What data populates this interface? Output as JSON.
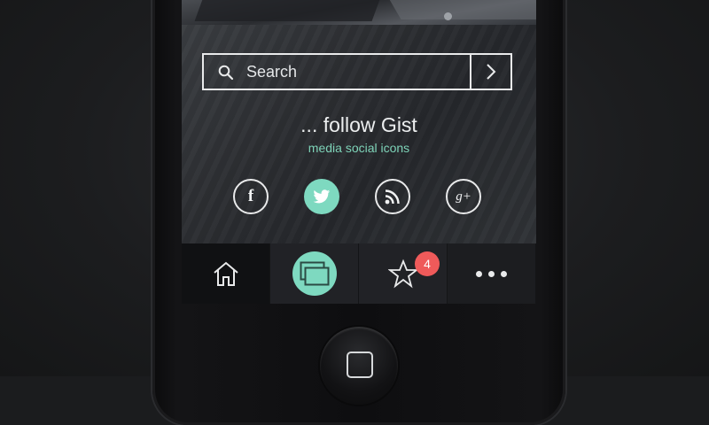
{
  "search": {
    "placeholder": "Search",
    "icon": "search-icon",
    "submit_icon": "chevron-right-icon"
  },
  "follow": {
    "title": "... follow Gist",
    "subtitle": "media social icons"
  },
  "social": [
    {
      "name": "facebook",
      "icon": "facebook-icon",
      "glyph": "f"
    },
    {
      "name": "twitter",
      "icon": "twitter-icon"
    },
    {
      "name": "rss",
      "icon": "rss-icon"
    },
    {
      "name": "google-plus",
      "icon": "google-plus-icon",
      "glyph": "g+"
    }
  ],
  "nav": {
    "items": [
      {
        "name": "home",
        "icon": "home-icon"
      },
      {
        "name": "windows",
        "icon": "windows-icon"
      },
      {
        "name": "favorites",
        "icon": "star-icon",
        "badge": "4"
      },
      {
        "name": "more",
        "icon": "more-icon"
      }
    ]
  },
  "colors": {
    "accent": "#7ed9c0",
    "badge": "#ef5a5a",
    "text": "#eceeef"
  }
}
